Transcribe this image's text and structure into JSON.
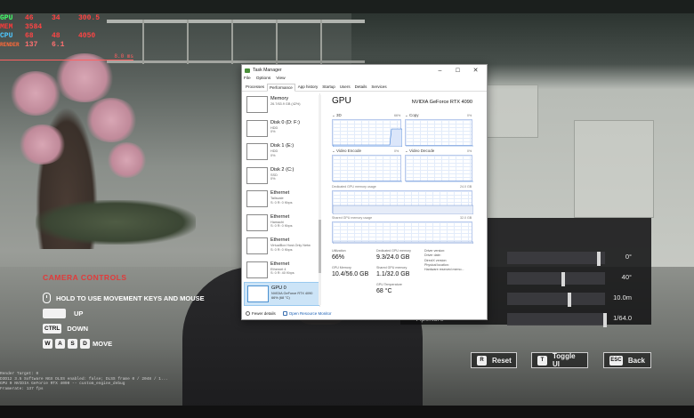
{
  "overlay": {
    "rows": [
      {
        "label": "GPU",
        "values": [
          "46",
          "34",
          "300.5"
        ]
      },
      {
        "label": "MEM",
        "values": [
          "3584",
          "",
          ""
        ]
      },
      {
        "label": "CPU",
        "values": [
          "68",
          "48",
          "4050"
        ]
      },
      {
        "label": "RENDER",
        "values": [
          "137",
          "6.1",
          ""
        ]
      }
    ],
    "frametime_value": "8.0 ms"
  },
  "task_manager": {
    "title": "Task Manager",
    "menu": [
      "File",
      "Options",
      "View"
    ],
    "tabs": [
      "Processes",
      "Performance",
      "App history",
      "Startup",
      "Users",
      "Details",
      "Services"
    ],
    "active_tab": "Performance",
    "sidebar": [
      {
        "name": "Memory",
        "sub1": "26.7/63.9 GB (42%)",
        "sub2": ""
      },
      {
        "name": "Disk 0 (D: F:)",
        "sub1": "HDD",
        "sub2": "0%"
      },
      {
        "name": "Disk 1 (E:)",
        "sub1": "HDD",
        "sub2": "0%"
      },
      {
        "name": "Disk 2 (C:)",
        "sub1": "SSD",
        "sub2": "0%"
      },
      {
        "name": "Ethernet",
        "sub1": "Tailscale",
        "sub2": "S: 0 R: 0 Kbps"
      },
      {
        "name": "Ethernet",
        "sub1": "Hamachi",
        "sub2": "S: 0 R: 0 Kbps"
      },
      {
        "name": "Ethernet",
        "sub1": "VirtualBox Host-Only Netw",
        "sub2": "S: 0 R: 0 Kbps"
      },
      {
        "name": "Ethernet",
        "sub1": "Ethernet 4",
        "sub2": "S: 0 R: 40 Kbps"
      },
      {
        "name": "GPU 0",
        "sub1": "NVIDIA GeForce RTX 4090",
        "sub2": "66% (68 °C)"
      }
    ],
    "gpu": {
      "heading": "GPU",
      "model": "NVIDIA GeForce RTX 4090",
      "engines": [
        {
          "name": "3D",
          "pct": "66%"
        },
        {
          "name": "Copy",
          "pct": "0%"
        },
        {
          "name": "Video Encode",
          "pct": "0%"
        },
        {
          "name": "Video Decode",
          "pct": "0%"
        }
      ],
      "dedicated_label": "Dedicated GPU memory usage",
      "dedicated_max": "24.0 GB",
      "shared_label": "Shared GPU memory usage",
      "shared_max": "32.0 GB",
      "stats": {
        "utilization_label": "Utilization",
        "utilization": "66%",
        "dedicated_mem_label": "Dedicated GPU memory",
        "dedicated_mem": "9.3/24.0 GB",
        "gpu_mem_label": "GPU Memory",
        "gpu_mem": "10.4/56.0 GB",
        "shared_mem_label": "Shared GPU memory",
        "shared_mem": "1.1/32.0 GB",
        "temp_label": "GPU Temperature",
        "temp": "68 °C"
      },
      "driver_info": [
        "Driver version:",
        "Driver date:",
        "DirectX version:",
        "Physical location:",
        "Hardware reserved memo..."
      ]
    },
    "footer": {
      "fewer": "Fewer details",
      "resmon": "Open Resource Monitor"
    }
  },
  "camera_controls": {
    "title": "CAMERA CONTROLS",
    "hint": "HOLD TO USE MOVEMENT KEYS AND MOUSE",
    "up_key": "",
    "up": "UP",
    "down_key": "CTRL",
    "down": "DOWN",
    "move_keys": [
      "W",
      "A",
      "S",
      "D"
    ],
    "move": "MOVE"
  },
  "photo_settings": {
    "rows": [
      {
        "label": "",
        "value": "0°",
        "level": 0.92
      },
      {
        "label": "",
        "value": "40°",
        "level": 0.55
      },
      {
        "label": "",
        "value": "10.0m",
        "level": 0.62
      },
      {
        "label": "Aperture",
        "value": "1/64.0",
        "level": 0.98
      }
    ]
  },
  "buttons": [
    {
      "key": "R",
      "label": "Reset"
    },
    {
      "key": "T",
      "label": "Toggle UI"
    },
    {
      "key": "ESC",
      "label": "Back"
    }
  ],
  "console_lines": [
    "Render Target: 0",
    "D3D12 3.5 Software NGX DLSS enabled: false; DLSS frame 0 / 2048 / 1...",
    "GPU 0  NVIDIA GeForce RTX 4090  -- custom_engine_debug",
    "Framerate: 137 fps"
  ]
}
